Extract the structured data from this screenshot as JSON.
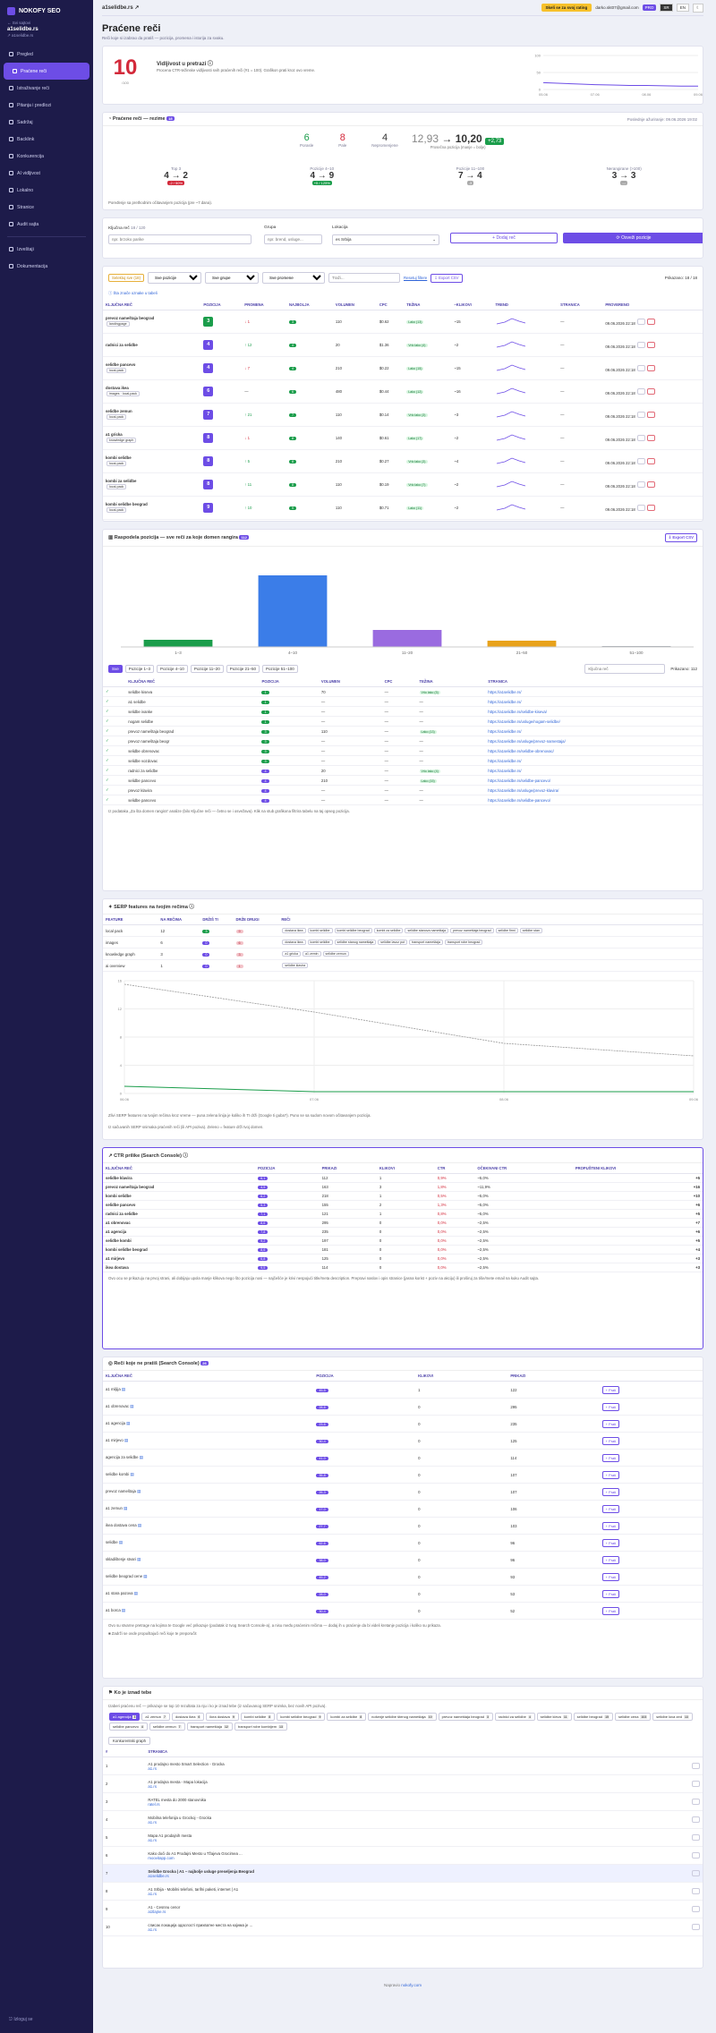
{
  "sidebar": {
    "brand": "NOKOFY SEO",
    "back": "Svi sajtovi",
    "site": "a1selidbe.rs",
    "site_url": "a1selidbe.rs",
    "items": [
      {
        "label": "Pregled"
      },
      {
        "label": "Praćene reči",
        "active": true
      },
      {
        "label": "Istraživanje reči"
      },
      {
        "label": "Pitanja i predlozi"
      },
      {
        "label": "Sadržaj"
      },
      {
        "label": "Backlink"
      },
      {
        "label": "Konkurencija"
      },
      {
        "label": "AI vidljivost"
      },
      {
        "label": "Lokalno"
      },
      {
        "label": "Stranice"
      },
      {
        "label": "Audit sajta"
      }
    ],
    "items2": [
      {
        "label": "Izveštaji"
      },
      {
        "label": "Dokumentacija"
      }
    ],
    "logout": "Izloguj se"
  },
  "topbar": {
    "site": "a1selidbe.rs",
    "cta": "Skeli se za svoj rating",
    "email": "darko.skt07@gmail.com",
    "plan": "PRO",
    "langs": [
      "SR",
      "EN"
    ]
  },
  "page": {
    "title": "Praćene reči",
    "subtitle": "Reči koje si izabrao da pratiš — pozicija, promena i istorija za svaku."
  },
  "vis": {
    "score": "10",
    "of": "/100",
    "title": "Vidljivost u pretrazi",
    "desc": "Procena CTR-težinske vidljivosti svih praćenih reči (#1 = 100). Grafikon prati kroz ovo vreme.",
    "yticks": [
      "100",
      "50",
      "0"
    ],
    "xticks": [
      "05.06",
      "07.06",
      "08.06",
      "09.06"
    ],
    "series": [
      20,
      18,
      16,
      14,
      13,
      12,
      12,
      11,
      10,
      10
    ]
  },
  "summary": {
    "title": "Praćene reči — rezime",
    "count": "18",
    "updated": "Poslednje ažuriranje: 09.06.2026 19:02",
    "stats": [
      {
        "v": "6",
        "l": "Porasle",
        "c": "grn"
      },
      {
        "v": "8",
        "l": "Pale",
        "c": "red"
      },
      {
        "v": "4",
        "l": "Nepromenjene",
        "c": ""
      }
    ],
    "avg_from": "12,93",
    "avg_to": "10,20",
    "avg_delta": "+2,73",
    "avg_label": "Prosečna pozicija (manje = bolje)",
    "buckets": [
      {
        "label": "Top 3",
        "from": "4",
        "to": "2",
        "delta": "-2 / 50%"
      },
      {
        "label": "Pozicije 4–10",
        "from": "4",
        "to": "9",
        "delta": "+5 / 125%"
      },
      {
        "label": "Pozicije 11–100",
        "from": "7",
        "to": "4",
        "delta": "-3"
      },
      {
        "label": "Nerangirane (>100)",
        "from": "3",
        "to": "3",
        "delta": "—"
      }
    ],
    "note": "Poređenje sa prethodnim očitavanjem pozicija (pre ~7 dana)."
  },
  "addform": {
    "kw_label": "Ključna reč",
    "kw_count": "18 / 120",
    "kw_ph": "npr. brzoko parike",
    "group_label": "Grupa",
    "group_ph": "npr. brend, usluge...",
    "loc_label": "Lokacija",
    "loc_val": "es Srbija",
    "add": "+ Dodaj reč",
    "refresh": "⟳ Osveži pozicije"
  },
  "filters": {
    "sel": "Selektuj sve (18)",
    "f1": "Sve pozicije",
    "f2": "Sve grupe",
    "f3": "Sve promene",
    "search": "Traži...",
    "reset": "Resetuj filtere",
    "export": "⇩ Export CSV",
    "shown": "Prikazano: 18 / 18",
    "hint": "Šta znače oznake u tabeli"
  },
  "kwtable": {
    "headers": [
      "KLJUČNA REČ",
      "POZICIJA",
      "PROMENA",
      "NAJBOLJA",
      "VOLUMEN",
      "CPC",
      "TEŽINA",
      "~KLIKOVI",
      "TREND",
      "STRANICA",
      "PROVERENO"
    ],
    "rows": [
      {
        "kw": "prevoz nameštaja beograd",
        "tag": "landingpage",
        "pos": "3",
        "ch": "↓ 1",
        "best": "3",
        "vol": "110",
        "cpc": "$0.62",
        "diff": "Lako (13)",
        "clk": "~15",
        "date": "09.06.2026 22:18"
      },
      {
        "kw": "radnici za selidbe",
        "tag": "",
        "pos": "4",
        "ch": "↑ 12",
        "best": "4",
        "vol": "20",
        "cpc": "$1.36",
        "diff": "Vrlo lako (4)",
        "clk": "~2",
        "date": "09.06.2026 22:18"
      },
      {
        "kw": "selidbe pancevo",
        "tag": "local-pack",
        "pos": "4",
        "ch": "↓ 7",
        "best": "4",
        "vol": "210",
        "cpc": "$0.22",
        "diff": "Lako (15)",
        "clk": "~15",
        "date": "09.06.2026 22:18"
      },
      {
        "kw": "dostava ikea",
        "tag": "images · local-pack",
        "pos": "6",
        "ch": "—",
        "best": "6",
        "vol": "480",
        "cpc": "$0.44",
        "diff": "Lako (12)",
        "clk": "~16",
        "date": "09.06.2026 22:18"
      },
      {
        "kw": "selidbe zemun",
        "tag": "local-pack",
        "pos": "7",
        "ch": "↑ 21",
        "best": "7",
        "vol": "110",
        "cpc": "$0.14",
        "diff": "Vrlo lako (3)",
        "clk": "~3",
        "date": "09.06.2026 22:18"
      },
      {
        "kw": "a1 gricka",
        "tag": "knowledge graph",
        "pos": "8",
        "ch": "↓ 1",
        "best": "8",
        "vol": "140",
        "cpc": "$0.61",
        "diff": "Lako (17)",
        "clk": "~2",
        "date": "09.06.2026 22:18"
      },
      {
        "kw": "kombi selidbe",
        "tag": "local-pack",
        "pos": "8",
        "ch": "↑ 5",
        "best": "8",
        "vol": "210",
        "cpc": "$0.27",
        "diff": "Vrlo lako (3)",
        "clk": "~4",
        "date": "09.06.2026 22:18"
      },
      {
        "kw": "kombi za selidbe",
        "tag": "local-pack",
        "pos": "8",
        "ch": "↑ 11",
        "best": "8",
        "vol": "110",
        "cpc": "$0.19",
        "diff": "Vrlo lako (7)",
        "clk": "~2",
        "date": "09.06.2026 22:18"
      },
      {
        "kw": "kombi selidbe beograd",
        "tag": "local-pack",
        "pos": "9",
        "ch": "↑ 10",
        "best": "9",
        "vol": "110",
        "cpc": "$0.71",
        "diff": "Lako (11)",
        "clk": "~2",
        "date": "09.06.2026 22:18"
      }
    ]
  },
  "dist": {
    "title": "Raspodela pozicija — sve reči za koje domen rangira",
    "count": "112",
    "export": "⇩ Export CSV",
    "cats": [
      "1–3",
      "4–10",
      "11–20",
      "21–50",
      "51–100"
    ],
    "values": [
      8,
      80,
      19,
      7,
      1
    ],
    "colors": [
      "#1b9d4b",
      "#3b7de8",
      "#9a6be0",
      "#e8a21b",
      "#9aa0aa"
    ],
    "tabs": [
      "Sve",
      "Pozicije 1–3",
      "Pozicije 4–10",
      "Pozicije 11–20",
      "Pozicije 21–50",
      "Pozicije 51–100"
    ],
    "search": "Ključna reč",
    "shown": "Prikazano: 112",
    "headers": [
      "",
      "KLJUČNA REČ",
      "POZICIJA",
      "VOLUMEN",
      "CPC",
      "TEŽINA",
      "STRANICA"
    ],
    "rows": [
      {
        "kw": "selidbe kiseva",
        "pos": "1",
        "vol": "70",
        "cpc": "—",
        "diff": "Vrlo lako (5)",
        "url": "https://a1selidbe.rs/"
      },
      {
        "kw": "a1 selidbe",
        "pos": "1",
        "vol": "—",
        "cpc": "—",
        "diff": "—",
        "url": "https://a1selidbe.rs/"
      },
      {
        "kw": "selidbe ivanke",
        "pos": "1",
        "vol": "—",
        "cpc": "—",
        "diff": "—",
        "url": "https://a1selidbe.rs/selidbe-kiseva/"
      },
      {
        "kw": "nogam selidbe",
        "pos": "1",
        "vol": "—",
        "cpc": "—",
        "diff": "—",
        "url": "https://a1selidbe.rs/usluge/nogam-selidbe/"
      },
      {
        "kw": "prevoz nameštaja beograd",
        "pos": "3",
        "vol": "110",
        "cpc": "—",
        "diff": "Lako (13)",
        "url": "https://a1selidbe.rs/"
      },
      {
        "kw": "prevoz nameštaja beogr",
        "pos": "3",
        "vol": "—",
        "cpc": "—",
        "diff": "—",
        "url": "https://a1selidbe.rs/usluge/prevoz-namestaja/"
      },
      {
        "kw": "selidbe obrenovac",
        "pos": "3",
        "vol": "—",
        "cpc": "—",
        "diff": "—",
        "url": "https://a1selidbe.rs/selidbe-obrenovac/"
      },
      {
        "kw": "selidbe vozdovac",
        "pos": "3",
        "vol": "—",
        "cpc": "—",
        "diff": "—",
        "url": "https://a1selidbe.rs/"
      },
      {
        "kw": "radnici za selidbe",
        "pos": "4",
        "vol": "20",
        "cpc": "—",
        "diff": "Vrlo lako (4)",
        "url": "https://a1selidbe.rs/"
      },
      {
        "kw": "selidbe pancevo",
        "pos": "4",
        "vol": "210",
        "cpc": "—",
        "diff": "Lako (15)",
        "url": "https://a1selidbe.rs/selidbe-pancevo/"
      },
      {
        "kw": "prevoz klavira",
        "pos": "4",
        "vol": "—",
        "cpc": "—",
        "diff": "—",
        "url": "https://a1selidbe.rs/usluge/prevoz-klavira/"
      },
      {
        "kw": "selidbe pancevo",
        "pos": "4",
        "vol": "—",
        "cpc": "—",
        "diff": "—",
        "url": "https://a1selidbe.rs/selidbe-pancevo/"
      }
    ],
    "note": "Iz podataka „Za šta domen rangira“ analize (bilo Ključne reči — četno se i osvežava). Klik na stub grafikona filtrira tabelu na taj opseg pozicija."
  },
  "serp": {
    "title": "SERP features na tvojim rečima",
    "headers": [
      "FEATURE",
      "NA REČIMA",
      "DRŽIŠ TI",
      "DRŽE DRUGI",
      "REČI"
    ],
    "rows": [
      {
        "f": "local pack",
        "n": "12",
        "you": "3",
        "oth": "9",
        "kws": [
          "dostava ikea",
          "kombi selidbe",
          "kombi selidbe beograd",
          "kombi za selidbe",
          "selidbe stanova nameštaja",
          "prevoz nameštaja beograd",
          "selidbe firmi",
          "selidbe stan"
        ]
      },
      {
        "f": "images",
        "n": "6",
        "you": "0",
        "oth": "6",
        "kws": [
          "dostava ikea",
          "kombi selidbe",
          "selidbe stanog nameštaja",
          "selidbe lavoz put",
          "transport nameštaja",
          "transport robe beograd"
        ]
      },
      {
        "f": "knowledge graph",
        "n": "3",
        "you": "0",
        "oth": "3",
        "kws": [
          "a1 gricka",
          "a1 zemin",
          "selidbe zemun"
        ]
      },
      {
        "f": "ai overview",
        "n": "1",
        "you": "0",
        "oth": "1",
        "kws": [
          "selidbe klavira"
        ]
      }
    ],
    "chart_ticks_y": [
      "16",
      "12",
      "8",
      "4",
      "0"
    ],
    "chart_ticks_x": [
      "06.06",
      "07.06",
      "08.06",
      "09.06"
    ],
    "note1": "Zlivi SERP features na tvojim rečima kroz vreme — puna zelena linija je koliko ih TI drži (Google ti guba?). Puno se sa sudom novom očitavanjem pozicija.",
    "note2": "Iz sačuvanih SERP snimaka praćenih reči (ili API poziva). Zeleno = feature drži tvoj domen."
  },
  "ctr": {
    "title": "CTR prilike (Search Console)",
    "headers": [
      "KLJUČNA REČ",
      "POZICIJA",
      "PRIKAZI",
      "KLIKOVI",
      "CTR",
      "OČEKIVANI CTR",
      "PROPUŠTENI KLIKOVI"
    ],
    "rows": [
      {
        "kw": "selidbe klavira",
        "pos": "6,1",
        "imp": "112",
        "clk": "1",
        "ctr": "0,9%",
        "exp": "~5,0%",
        "miss": "+5"
      },
      {
        "kw": "prevoz nameštaja beograd",
        "pos": "4,5",
        "imp": "163",
        "clk": "3",
        "ctr": "1,8%",
        "exp": "~11,9%",
        "miss": "+16"
      },
      {
        "kw": "kombi selidbe",
        "pos": "6,2",
        "imp": "218",
        "clk": "1",
        "ctr": "0,5%",
        "exp": "~5,0%",
        "miss": "+10"
      },
      {
        "kw": "selidbe pancevo",
        "pos": "5,3",
        "imp": "155",
        "clk": "2",
        "ctr": "1,3%",
        "exp": "~5,0%",
        "miss": "+6"
      },
      {
        "kw": "radnici za selidbe",
        "pos": "7,1",
        "imp": "121",
        "clk": "1",
        "ctr": "0,8%",
        "exp": "~5,0%",
        "miss": "+5"
      },
      {
        "kw": "a1 obrenovac",
        "pos": "8,6",
        "imp": "295",
        "clk": "0",
        "ctr": "0,0%",
        "exp": "~2,5%",
        "miss": "+7"
      },
      {
        "kw": "a1 agencija",
        "pos": "7,8",
        "imp": "235",
        "clk": "0",
        "ctr": "0,0%",
        "exp": "~2,5%",
        "miss": "+6"
      },
      {
        "kw": "selidbe kombi",
        "pos": "9,2",
        "imp": "197",
        "clk": "0",
        "ctr": "0,0%",
        "exp": "~2,5%",
        "miss": "+5"
      },
      {
        "kw": "kombi selidbe beograd",
        "pos": "8,6",
        "imp": "181",
        "clk": "0",
        "ctr": "0,0%",
        "exp": "~2,5%",
        "miss": "+4"
      },
      {
        "kw": "a1 mirjevo",
        "pos": "6,8",
        "imp": "125",
        "clk": "0",
        "ctr": "0,0%",
        "exp": "~2,5%",
        "miss": "+3"
      },
      {
        "kw": "ikea dostava",
        "pos": "9,5",
        "imp": "114",
        "clk": "0",
        "ctr": "0,0%",
        "exp": "~2,5%",
        "miss": "+3"
      }
    ],
    "note": "Ovo ocu se prikazuju na prvoj strani, ali dobijaju upola manje klikova nego što pozicija nosi — najčešće je krivi nespojući title/meta description. Prepravi naslov i opis stranice (jasna korist + poziv na akciju) ili proširuj za tiše/mete email na kuku Audit sajta."
  },
  "untracked": {
    "title": "Reči koje ne pratiš (Search Console)",
    "count": "26",
    "headers": [
      "KLJUČNA REČ",
      "POZICIJA",
      "KLIKOVI",
      "PRIKAZI",
      ""
    ],
    "btn": "+ Prati",
    "rows": [
      {
        "kw": "a1 miljija",
        "pos": "45,5",
        "clk": "1",
        "imp": "122"
      },
      {
        "kw": "a1 obrenovac",
        "pos": "28,6",
        "clk": "0",
        "imp": "295"
      },
      {
        "kw": "a1 agencija",
        "pos": "23,6",
        "clk": "0",
        "imp": "235"
      },
      {
        "kw": "a1 mirjevo",
        "pos": "30,4",
        "clk": "0",
        "imp": "125"
      },
      {
        "kw": "agencija za selidbe",
        "pos": "41,0",
        "clk": "0",
        "imp": "114"
      },
      {
        "kw": "selidbe kombi",
        "pos": "35,8",
        "clk": "0",
        "imp": "107"
      },
      {
        "kw": "prevoz nameštaja",
        "pos": "26,3",
        "clk": "0",
        "imp": "107"
      },
      {
        "kw": "a1 zemun",
        "pos": "17,0",
        "clk": "0",
        "imp": "106"
      },
      {
        "kw": "ikea dostava cena",
        "pos": "27,7",
        "clk": "0",
        "imp": "103"
      },
      {
        "kw": "selidbe",
        "pos": "62,6",
        "clk": "0",
        "imp": "96"
      },
      {
        "kw": "skladištenje stvari",
        "pos": "38,0",
        "clk": "0",
        "imp": "96"
      },
      {
        "kw": "selidbe beograd cene",
        "pos": "45,2",
        "clk": "0",
        "imp": "93"
      },
      {
        "kw": "a1 stara pazova",
        "pos": "28,0",
        "clk": "0",
        "imp": "53"
      },
      {
        "kw": "a1 borca",
        "pos": "30,4",
        "clk": "0",
        "imp": "52"
      }
    ],
    "note": "Ovo su stvarne pretrage na kojima te Google već prikazuje (podatak iz tvog Search Console-a), a nisu među praćenim rečima — dodaj ih u praćenje da bi videli kretanje pozicija i koliko su prikaza.",
    "check": "Zadrži se ovde propuštajući reči koje te preporučit"
  },
  "who": {
    "title": "Ko je iznad tebe",
    "desc": "Izaberi praćenu reč — prikazuje se top 10 rezultata za nju i ko je iznad tebe (iz sačuvanog SERP snimka, bez novih API poziva).",
    "chips": [
      {
        "t": "a1 agencija",
        "n": "8",
        "on": true
      },
      {
        "t": "a1 zemun",
        "n": "7"
      },
      {
        "t": "dostava ikea",
        "n": "6"
      },
      {
        "t": "ikea dostava",
        "n": "9"
      },
      {
        "t": "kombi selidbe",
        "n": "8"
      },
      {
        "t": "kombi selidbe beograd",
        "n": "9"
      },
      {
        "t": "kombi za selidbe",
        "n": "8"
      },
      {
        "t": "nošenje selidbe štenog nameštaja",
        "n": "10"
      },
      {
        "t": "prevoz nameštaja beograd",
        "n": "3"
      },
      {
        "t": "radnici za selidbe",
        "n": "4"
      },
      {
        "t": "selidbe kleva",
        "n": "11"
      },
      {
        "t": "selidbe beograd",
        "n": "15"
      },
      {
        "t": "selidbe cena",
        "n": "103"
      },
      {
        "t": "selidbe lova zed",
        "n": "13"
      },
      {
        "t": "selidbe pancevo",
        "n": "4"
      },
      {
        "t": "selidbe zemun",
        "n": "7"
      },
      {
        "t": "transport nameštaja",
        "n": "12"
      },
      {
        "t": "transport robe kombijem",
        "n": "13"
      }
    ],
    "sub": "Konkurentski graph",
    "headers": [
      "#",
      "STRANICA",
      ""
    ],
    "rows": [
      {
        "n": "1",
        "t": "A1 prodajno mesto Smart Selection - Grocka",
        "u": "a1.rs"
      },
      {
        "n": "2",
        "t": "A1 prodajna mesta - Mapa lokacija",
        "u": "a1.rs"
      },
      {
        "n": "3",
        "t": "RATEL mesta do 2000 stanovnika",
        "u": "ratel.rs"
      },
      {
        "n": "4",
        "t": "Mobilna telefonija u Grockoj - Grocka",
        "u": "a1.rs"
      },
      {
        "n": "5",
        "t": "Mapa A1 prodajnih mesta",
        "u": "a1.rs"
      },
      {
        "n": "6",
        "t": "Kako doći do A1 Prodajni Mesto u Tžajeva Grocimea ...",
        "u": "moovitapp.com"
      },
      {
        "n": "7",
        "t": "Selidbe Grocka | A1 – najbolje usluge preseljenja Beograd",
        "u": "a1selidbe.rs",
        "you": true
      },
      {
        "n": "8",
        "t": "A1 Srbija - Mobilni telefoni, tarifni paketi, internet | A1",
        "u": "a1.rs"
      },
      {
        "n": "9",
        "t": "A1 - Cesnnu cenor",
        "u": "a1tlajne.rs"
      },
      {
        "n": "10",
        "t": "списак локација одаслостi прихватне места на којима је ...",
        "u": "a1.rs"
      }
    ]
  },
  "footer": {
    "text": "Napravio ",
    "brand": "nokofy.com"
  }
}
